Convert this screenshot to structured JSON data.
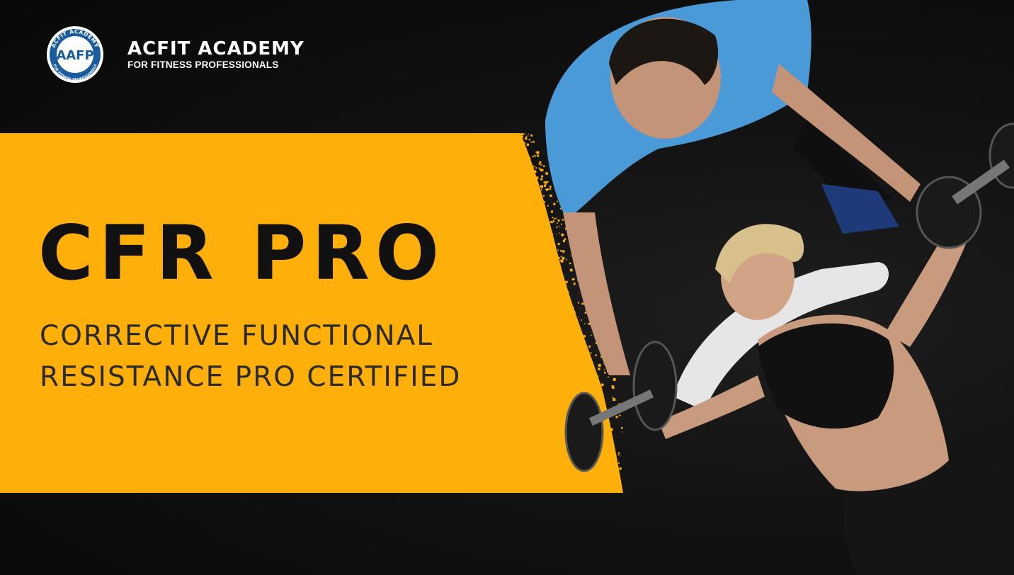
{
  "brand": {
    "badge_text": "AAFP",
    "badge_ring_top": "ACFIT ACADEMY",
    "badge_ring_bottom": "FOR FITNESS PROFESSIONALS",
    "name": "ACFIT ACADEMY",
    "tagline": "FOR FITNESS PROFESSIONALS"
  },
  "hero": {
    "title": "CFR PRO",
    "subtitle_line1": "CORRECTIVE FUNCTIONAL",
    "subtitle_line2": "RESISTANCE PRO CERTIFIED"
  },
  "colors": {
    "accent": "#FEAF0A",
    "background": "#0b0b0b",
    "badge_blue": "#1a5c9e",
    "shirt_blue": "#4a9ad8"
  },
  "image": {
    "subject": "trainer-spotting-dumbbell-press-photo"
  }
}
